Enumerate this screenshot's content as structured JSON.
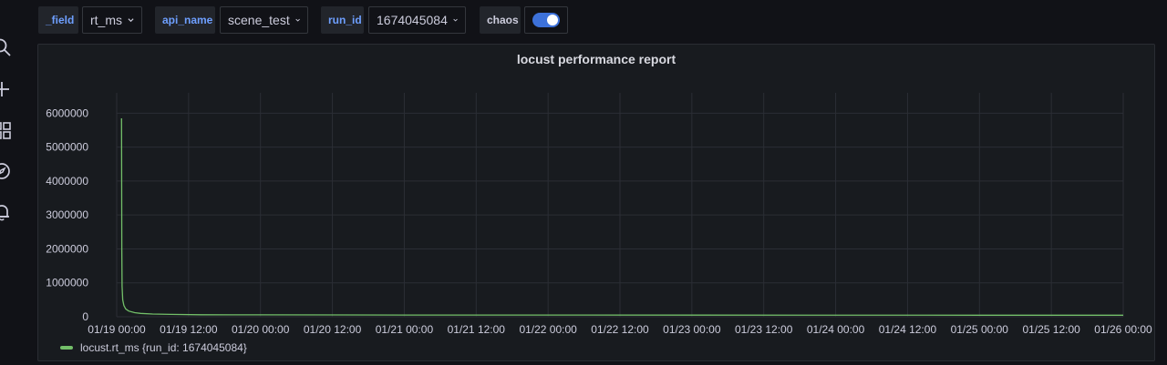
{
  "variables": [
    {
      "label": "_field",
      "value": "rt_ms"
    },
    {
      "label": "api_name",
      "value": "scene_test"
    },
    {
      "label": "run_id",
      "value": "1674045084"
    }
  ],
  "toggle": {
    "label": "chaos",
    "on": true
  },
  "panel": {
    "title": "locust performance report"
  },
  "colors": {
    "accent": "#3d71d9",
    "series": "#73bf69",
    "label": "#6e9fff"
  },
  "sidebar_icons": [
    "search-icon",
    "plus-icon",
    "dashboards-icon",
    "explore-icon",
    "bell-icon"
  ],
  "chart_data": {
    "type": "line",
    "title": "locust performance report",
    "y_ticks": [
      "6000000",
      "5000000",
      "4000000",
      "3000000",
      "2000000",
      "1000000",
      "0"
    ],
    "y_tick_values": [
      6000000,
      5000000,
      4000000,
      3000000,
      2000000,
      1000000,
      0
    ],
    "ylim": [
      0,
      6600000
    ],
    "x_ticks": [
      "01/19 00:00",
      "01/19 12:00",
      "01/20 00:00",
      "01/20 12:00",
      "01/21 00:00",
      "01/21 12:00",
      "01/22 00:00",
      "01/22 12:00",
      "01/23 00:00",
      "01/23 12:00",
      "01/24 00:00",
      "01/24 12:00",
      "01/25 00:00",
      "01/25 12:00",
      "01/26 00:00"
    ],
    "x_tick_hours": [
      0,
      12,
      24,
      36,
      48,
      60,
      72,
      84,
      96,
      108,
      120,
      132,
      144,
      156,
      168
    ],
    "xlim_hours": [
      0,
      168
    ],
    "grid": true,
    "legend_position": "bottom-left",
    "series": [
      {
        "name": "locust.rt_ms {run_id: 1674045084}",
        "x_hours": [
          0.8,
          0.85,
          0.9,
          1.0,
          1.2,
          1.5,
          2,
          3,
          4,
          6,
          9,
          14,
          24,
          48,
          96,
          144,
          168
        ],
        "values": [
          5850000,
          2000000,
          900000,
          500000,
          330000,
          230000,
          170000,
          120000,
          100000,
          80000,
          70000,
          60000,
          55000,
          50000,
          48000,
          46000,
          45000
        ]
      }
    ]
  }
}
